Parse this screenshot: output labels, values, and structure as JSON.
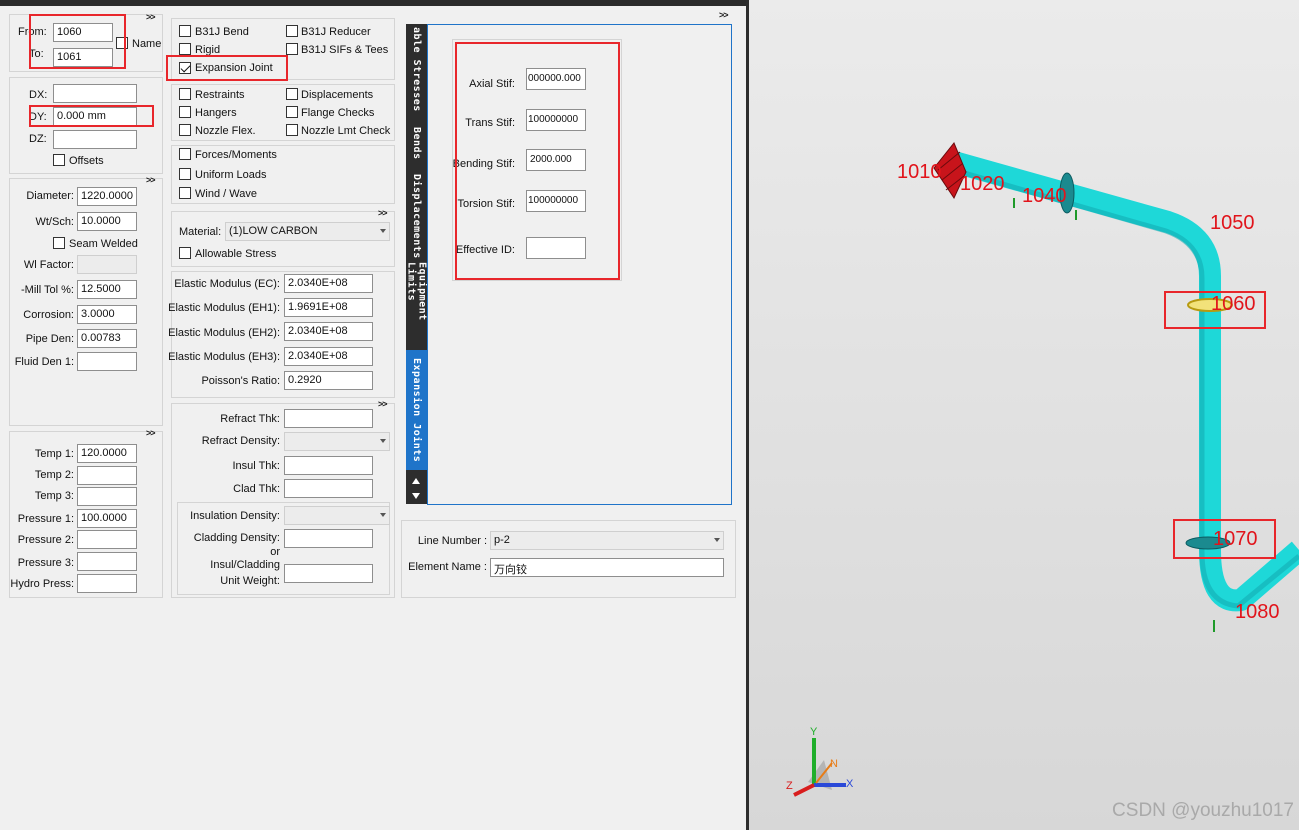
{
  "nodes": {
    "from_label": "From:",
    "from_value": "1060",
    "to_label": "To:",
    "to_value": "1061",
    "name_label": "Name"
  },
  "offsets": {
    "dx_label": "DX:",
    "dx_value": "",
    "dy_label": "DY:",
    "dy_value": "0.000 mm",
    "dz_label": "DZ:",
    "dz_value": "",
    "offsets_label": "Offsets"
  },
  "pipe": {
    "diameter_label": "Diameter:",
    "diameter_value": "1220.0000",
    "wtsch_label": "Wt/Sch:",
    "wtsch_value": "10.0000",
    "seam_welded_label": "Seam Welded",
    "wl_factor_label": "Wl Factor:",
    "wl_factor_value": "",
    "mill_tol_label": "-Mill Tol %:",
    "mill_tol_value": "12.5000",
    "corrosion_label": "Corrosion:",
    "corrosion_value": "3.0000",
    "pipe_den_label": "Pipe Den:",
    "pipe_den_value": "0.00783",
    "fluid_den_label": "Fluid Den 1:",
    "fluid_den_value": ""
  },
  "conditions": {
    "temp1_label": "Temp 1:",
    "temp1_value": "120.0000",
    "temp2_label": "Temp 2:",
    "temp2_value": "",
    "temp3_label": "Temp 3:",
    "temp3_value": "",
    "pressure1_label": "Pressure 1:",
    "pressure1_value": "100.0000",
    "pressure2_label": "Pressure 2:",
    "pressure2_value": "",
    "pressure3_label": "Pressure 3:",
    "pressure3_value": "",
    "hydro_label": "Hydro Press:",
    "hydro_value": ""
  },
  "element_types": {
    "b31j_bend": "B31J Bend",
    "b31j_reducer": "B31J Reducer",
    "rigid": "Rigid",
    "b31j_sifs": "B31J SIFs & Tees",
    "expansion_joint": "Expansion Joint"
  },
  "restraints": {
    "restraints": "Restraints",
    "displacements": "Displacements",
    "hangers": "Hangers",
    "flange_checks": "Flange Checks",
    "nozzle_flex": "Nozzle Flex.",
    "nozzle_lmt": "Nozzle Lmt Check"
  },
  "loads": {
    "forces": "Forces/Moments",
    "uniform": "Uniform Loads",
    "wind": "Wind / Wave"
  },
  "material": {
    "material_label": "Material:",
    "material_value": "(1)LOW CARBON",
    "allowable_stress": "Allowable Stress",
    "ec_label": "Elastic Modulus (EC):",
    "ec_value": "2.0340E+08",
    "eh1_label": "Elastic Modulus (EH1):",
    "eh1_value": "1.9691E+08",
    "eh2_label": "Elastic Modulus (EH2):",
    "eh2_value": "2.0340E+08",
    "eh3_label": "Elastic Modulus (EH3):",
    "eh3_value": "2.0340E+08",
    "poisson_label": "Poisson's Ratio:",
    "poisson_value": "0.2920"
  },
  "insulation": {
    "refract_thk_label": "Refract Thk:",
    "refract_den_label": "Refract Density:",
    "insul_thk_label": "Insul Thk:",
    "clad_thk_label": "Clad Thk:",
    "insul_den_label": "Insulation Density:",
    "clad_den_label": "Cladding Density:",
    "or_label": "or",
    "unit_weight_label_1": "Insul/Cladding",
    "unit_weight_label_2": "Unit Weight:"
  },
  "expansion_joint_panel": {
    "axial_label": "Axial Stif:",
    "axial_value": "000000.000",
    "trans_label": "Trans Stif:",
    "trans_value": "100000000",
    "bending_label": "Bending Stif:",
    "bending_value": "2000.000",
    "torsion_label": "Torsion Stif:",
    "torsion_value": "100000000",
    "eff_id_label": "Effective ID:",
    "eff_id_value": ""
  },
  "tabs": [
    "able Stresses",
    "Bends",
    "Displacements",
    "Equipment Limits",
    "Expansion Joints"
  ],
  "line_info": {
    "line_number_label": "Line Number :",
    "line_number_value": "p-2",
    "element_name_label": "Element Name :",
    "element_name_value": "万向铰"
  },
  "chevron": ">>",
  "viewport": {
    "node_labels": [
      "1010",
      "1020",
      "1040",
      "1050",
      "1060",
      "1070",
      "1080"
    ],
    "axis_x": "X",
    "axis_y": "Y",
    "axis_z": "Z",
    "axis_n": "N",
    "pipe_color": "#1ed8d8",
    "highlight_color": "#e8262b"
  },
  "watermark": "CSDN @youzhu1017"
}
